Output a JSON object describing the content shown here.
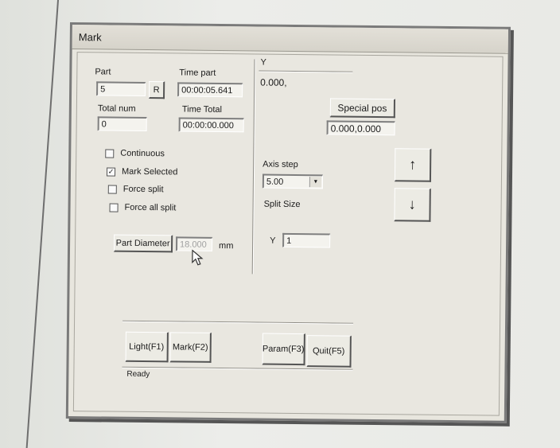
{
  "window": {
    "title": "Mark"
  },
  "left": {
    "part_label": "Part",
    "part_value": "5",
    "reset_button": "R",
    "time_part_label": "Time part",
    "time_part_value": "00:00:05.641",
    "total_num_label": "Total num",
    "total_num_value": "0",
    "time_total_label": "Time Total",
    "time_total_value": "00:00:00.000",
    "checkboxes": [
      {
        "label": "Continuous",
        "checked": false
      },
      {
        "label": "Mark Selected",
        "checked": true
      },
      {
        "label": "Force split",
        "checked": false
      },
      {
        "label": "Force all split",
        "checked": false
      }
    ],
    "part_diameter_button": "Part Diameter",
    "part_diameter_value": "18.000",
    "unit_mm": "mm"
  },
  "right": {
    "y_label": "Y",
    "y_value": "0.000,",
    "special_pos_button": "Special pos",
    "special_pos_value": "0.000,0.000",
    "axis_step_label": "Axis step",
    "axis_step_value": "5.00",
    "split_size_label": "Split Size",
    "split_y_label": "Y",
    "split_y_value": "1",
    "up_arrow": "↑",
    "down_arrow": "↓"
  },
  "bottom": {
    "light_button": "Light(F1)",
    "mark_button": "Mark(F2)",
    "param_button": "Param(F3)",
    "quit_button": "Quit(F5)",
    "status": "Ready"
  },
  "icons": {
    "cursor": "mouse-pointer-icon",
    "check": "checkmark-icon"
  }
}
